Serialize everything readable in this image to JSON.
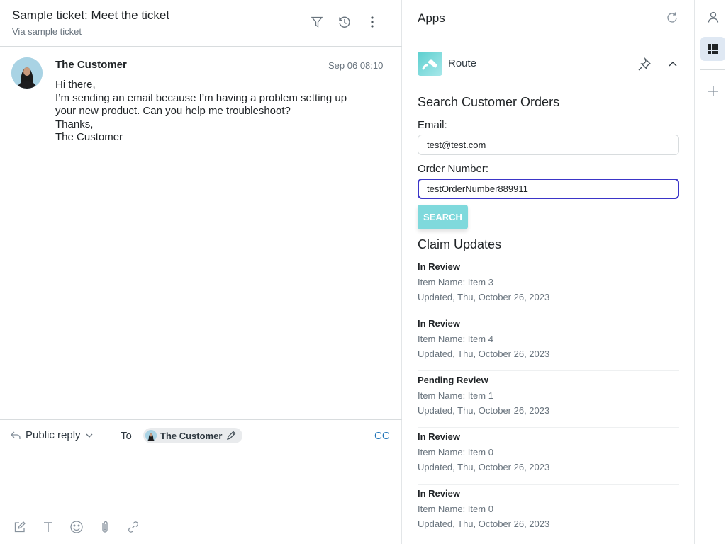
{
  "ticket": {
    "title": "Sample ticket: Meet the ticket",
    "subtitle": "Via sample ticket",
    "header_icons": [
      "filter-icon",
      "history-icon",
      "more-vertical-icon"
    ]
  },
  "message": {
    "author": "The Customer",
    "timestamp": "Sep 06 08:10",
    "body_lines": [
      "Hi there,",
      "I’m sending an email because I’m having a problem setting up",
      "your new product. Can you help me troubleshoot?",
      "Thanks,",
      "The Customer"
    ]
  },
  "reply": {
    "type_label": "Public reply",
    "to_label": "To",
    "recipient": "The Customer",
    "cc_label": "CC",
    "toolbar_icons": [
      "compose-icon",
      "text-format-icon",
      "emoji-icon",
      "attachment-icon",
      "link-icon"
    ]
  },
  "apps": {
    "title": "Apps",
    "app_name": "Route",
    "search_title": "Search Customer Orders",
    "email_label": "Email:",
    "email_value": "test@test.com",
    "order_label": "Order Number:",
    "order_value": "testOrderNumber889911",
    "search_button": "SEARCH",
    "claims_title": "Claim Updates",
    "claims": [
      {
        "status": "In Review",
        "item": "Item Name: Item 3",
        "updated": "Updated, Thu, October 26, 2023"
      },
      {
        "status": "In Review",
        "item": "Item Name: Item 4",
        "updated": "Updated, Thu, October 26, 2023"
      },
      {
        "status": "Pending Review",
        "item": "Item Name: Item 1",
        "updated": "Updated, Thu, October 26, 2023"
      },
      {
        "status": "In Review",
        "item": "Item Name: Item 0",
        "updated": "Updated, Thu, October 26, 2023"
      },
      {
        "status": "In Review",
        "item": "Item Name: Item 0",
        "updated": "Updated, Thu, October 26, 2023"
      }
    ]
  },
  "rail": {
    "items": [
      "user-icon",
      "apps-grid-icon",
      "add-icon"
    ],
    "active": "apps-grid-icon"
  },
  "colors": {
    "accent_focus": "#3b35c8",
    "search_button": "#7fd9dc",
    "link": "#1f73b7",
    "rail_active": "#dfe8f3"
  }
}
